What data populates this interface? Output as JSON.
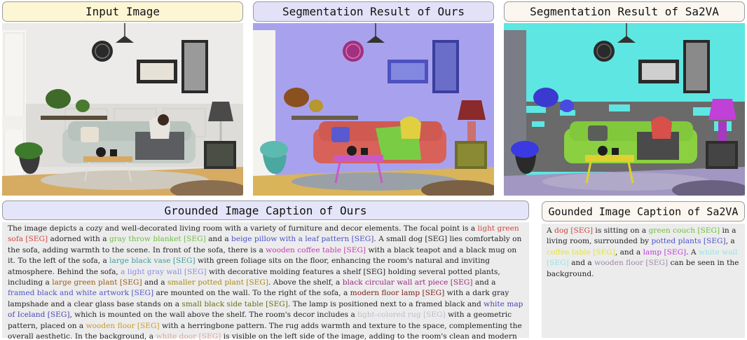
{
  "panels": {
    "input_title": "Input Image",
    "ours_title": "Segmentation Result of Ours",
    "sa2va_title": "Segmentation Result of Sa2VA"
  },
  "captions": {
    "ours_title": "Grounded Image Caption of Ours",
    "sa2va_title": "Gounded Image Caption of Sa2VA",
    "ours_segments": [
      {
        "t": "The image depicts a cozy and well-decorated living room with a variety of furniture and decor elements. The focal point is a "
      },
      {
        "t": "light green sofa [SEG]",
        "c": "#d0463c"
      },
      {
        "t": " adorned with a "
      },
      {
        "t": "gray throw blanket [SEG]",
        "c": "#6cbf3c"
      },
      {
        "t": " and a "
      },
      {
        "t": "beige pillow with a leaf pattern [SEG]",
        "c": "#4b4fcf"
      },
      {
        "t": ". A small dog [SEG] lies comfortably on the sofa, adding warmth to the scene. In front of the sofa, there is a "
      },
      {
        "t": "wooden coffee table [SEG]",
        "c": "#c339b5"
      },
      {
        "t": " with a black teapot and a black mug on it. To the left of the sofa, a "
      },
      {
        "t": "large black vase [SEG]",
        "c": "#3e9c9a"
      },
      {
        "t": " with green foliage sits on the floor, enhancing the room's natural and inviting atmosphere. Behind the sofa, "
      },
      {
        "t": "a light gray wall [SEG]",
        "c": "#8a8ae6"
      },
      {
        "t": " with decorative molding features a shelf [SEG] holding several potted plants, including a "
      },
      {
        "t": "large green plant [SEG]",
        "c": "#9a5a14"
      },
      {
        "t": " and a "
      },
      {
        "t": "smaller potted plant [SEG]",
        "c": "#a78c16"
      },
      {
        "t": ". Above the shelf, a "
      },
      {
        "t": "black circular wall art piece [SEG]",
        "c": "#9a2a7c"
      },
      {
        "t": " and a "
      },
      {
        "t": "framed black and white artwork [SEG]",
        "c": "#4f55c8"
      },
      {
        "t": " are mounted on the wall. To the right of the sofa, a "
      },
      {
        "t": "modern floor lamp [SEG]",
        "c": "#7a1c1c"
      },
      {
        "t": " with a dark gray lampshade and a clear glass base stands on a "
      },
      {
        "t": "small black side table [SEG]",
        "c": "#6b6b16"
      },
      {
        "t": ". The lamp is positioned next to a framed black and "
      },
      {
        "t": "white map of Iceland [SEG]",
        "c": "#4646b5"
      },
      {
        "t": ", which is mounted on the wall above the shelf. The room's decor includes a "
      },
      {
        "t": "light-colored rug [SEG]",
        "c": "#b9bfc8"
      },
      {
        "t": " with a geometric pattern, placed on a "
      },
      {
        "t": "wooden floor [SEG]",
        "c": "#c89a28"
      },
      {
        "t": " with a herringbone pattern. The rug adds warmth and texture to the space, complementing the overall aesthetic. In the background, a "
      },
      {
        "t": "white door [SEG]",
        "c": "#d8a89c"
      },
      {
        "t": " is visible on the left side of the image, adding to the room's clean and modern look. The overall setting suggests a well-decorated and inviting living space, with a mix of natural elements and modern furnishings."
      }
    ],
    "sa2va_segments": [
      {
        "t": "A "
      },
      {
        "t": "dog [SEG]",
        "c": "#d0463c"
      },
      {
        "t": " is sitting on a "
      },
      {
        "t": "green couch [SEG]",
        "c": "#6cbf3c"
      },
      {
        "t": " in a living room, surrounded by "
      },
      {
        "t": "potted plants [SEG]",
        "c": "#4b4fcf"
      },
      {
        "t": ", a "
      },
      {
        "t": "coffee table [SEG]",
        "c": "#e6e628"
      },
      {
        "t": ", and a "
      },
      {
        "t": "lamp [SEG]",
        "c": "#c339e0"
      },
      {
        "t": ". A "
      },
      {
        "t": "white wall [SEG]",
        "c": "#8fe6e6"
      },
      {
        "t": " and a "
      },
      {
        "t": "wooden floor [SEG]",
        "c": "#9a8aa6"
      },
      {
        "t": " can be seen in the background."
      }
    ]
  },
  "colors": {
    "wall_ours": "#a8a2ee",
    "wall_sa2va": "#5ee6e2",
    "floor": "#d9b45a",
    "sofa_ours": "#d8625a",
    "sofa_sa2va": "#8ad040",
    "table": "#c85ac8",
    "table_sa2va": "#e0d030",
    "lamp": "#c040d8"
  }
}
